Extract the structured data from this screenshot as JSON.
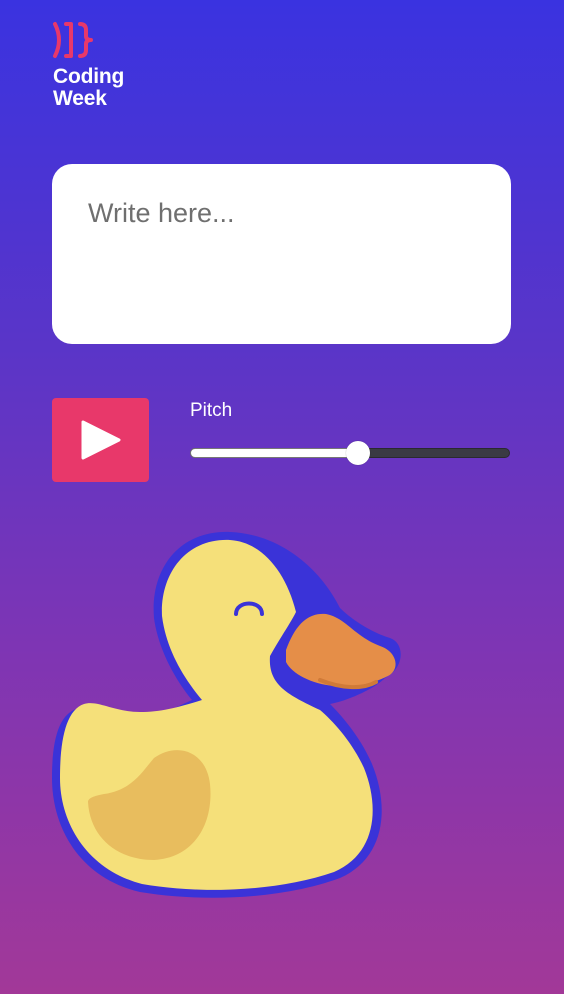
{
  "logo": {
    "line1": "Coding",
    "line2": "Week",
    "mark_color": "#e8386a"
  },
  "editor": {
    "placeholder": "Write here...",
    "value": ""
  },
  "controls": {
    "play_icon": "play-icon",
    "play_color": "#e8386a",
    "pitch_label": "Pitch",
    "pitch_value": 0.52
  },
  "illustration": {
    "name": "rubber-duck",
    "body_color": "#f5e07a",
    "wing_color": "#e8bd5e",
    "beak_color": "#e58e48",
    "outline_color": "#3a33d8"
  }
}
